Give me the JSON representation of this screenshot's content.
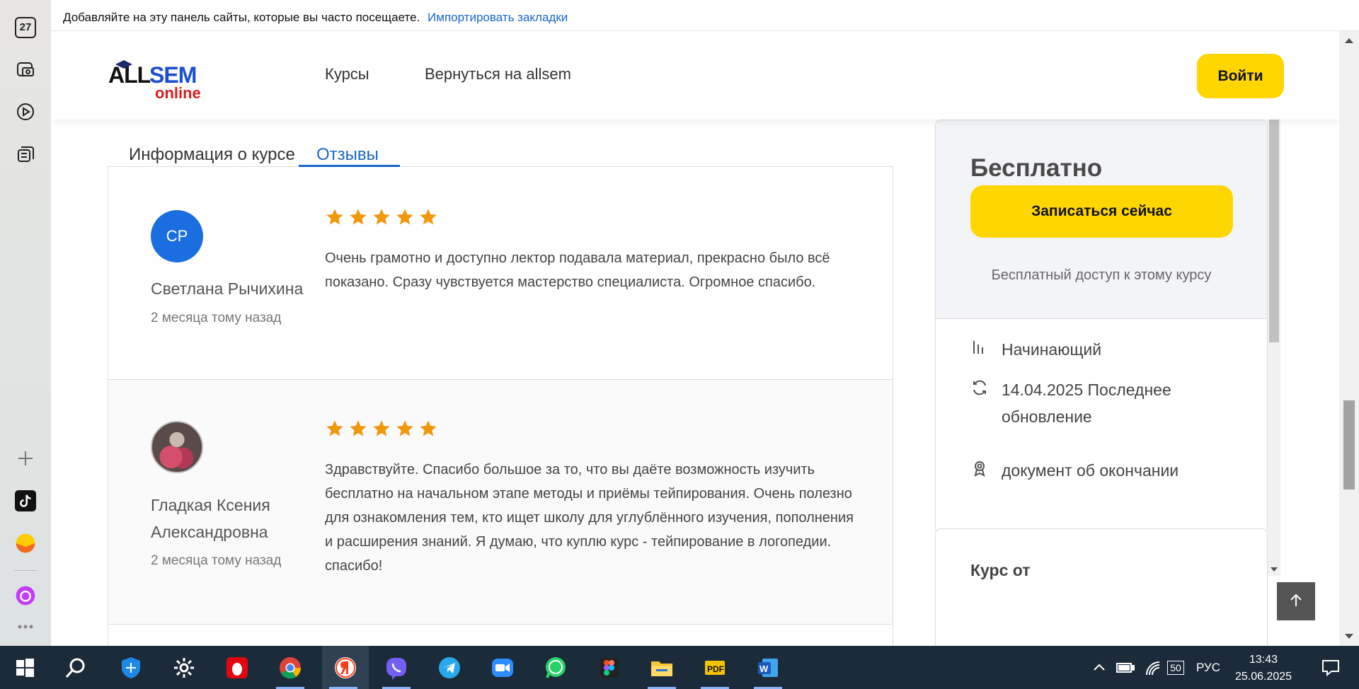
{
  "browser": {
    "sidebar_badge": "27",
    "bookmarks_message": "Добавляйте на эту панель сайты, которые вы часто посещаете.",
    "bookmarks_import_link": "Импортировать закладки"
  },
  "header": {
    "logo_text_top": "ALLSEM",
    "logo_text_bottom": "online",
    "nav": [
      "Курсы",
      "Вернуться на allsem"
    ],
    "login_label": "Войти"
  },
  "tabs": [
    {
      "label": "Информация о курсе",
      "active": false
    },
    {
      "label": "Отзывы",
      "active": true
    }
  ],
  "reviews": [
    {
      "initials": "СР",
      "name": "Светлана Рычихина",
      "date": "2 месяца тому назад",
      "rating": 5,
      "text": "Очень грамотно и доступно лектор подавала материал, прекрасно было всё показано. Сразу чувствуется мастерство специалиста. Огромное спасибо."
    },
    {
      "initials": "",
      "name": "Гладкая Ксения Александровна",
      "date": "2 месяца тому назад",
      "rating": 5,
      "text": "Здравствуйте. Спасибо большое за то, что вы даёте возможность изучить бесплатно на начальном этапе методы и приёмы тейпирования. Очень полезно для ознакомления тем, кто ищет школу для углублённого изучения, пополнения и расширения знаний. Я думаю, что куплю курс - тейпирование в логопедии. спасибо!"
    }
  ],
  "sidebar_card": {
    "price": "Бесплатно",
    "enroll_label": "Записаться сейчас",
    "free_access": "Бесплатный доступ к этому курсу",
    "features": [
      {
        "icon": "level-bars-icon",
        "text": "Начинающий"
      },
      {
        "icon": "refresh-icon",
        "text": "14.04.2025 Последнее обновление"
      },
      {
        "icon": "certificate-icon",
        "text": "документ об окончании"
      }
    ]
  },
  "author_card": {
    "title": "Курс от"
  },
  "taskbar": {
    "apps": [
      "windows-start-icon",
      "search-icon",
      "defender-icon",
      "settings-icon",
      "mts-icon",
      "chrome-icon",
      "yandex-browser-icon",
      "viber-icon",
      "telegram-icon",
      "zoom-icon",
      "whatsapp-icon",
      "figma-icon",
      "file-explorer-icon",
      "pdf-icon",
      "word-icon"
    ],
    "battery_label": "50",
    "language": "РУС",
    "time": "13:43",
    "date": "25.06.2025"
  },
  "colors": {
    "accent_yellow": "#ffd600",
    "link_blue": "#1a66cc",
    "star_orange": "#f0970c",
    "avatar_blue": "#1a6ee0"
  }
}
